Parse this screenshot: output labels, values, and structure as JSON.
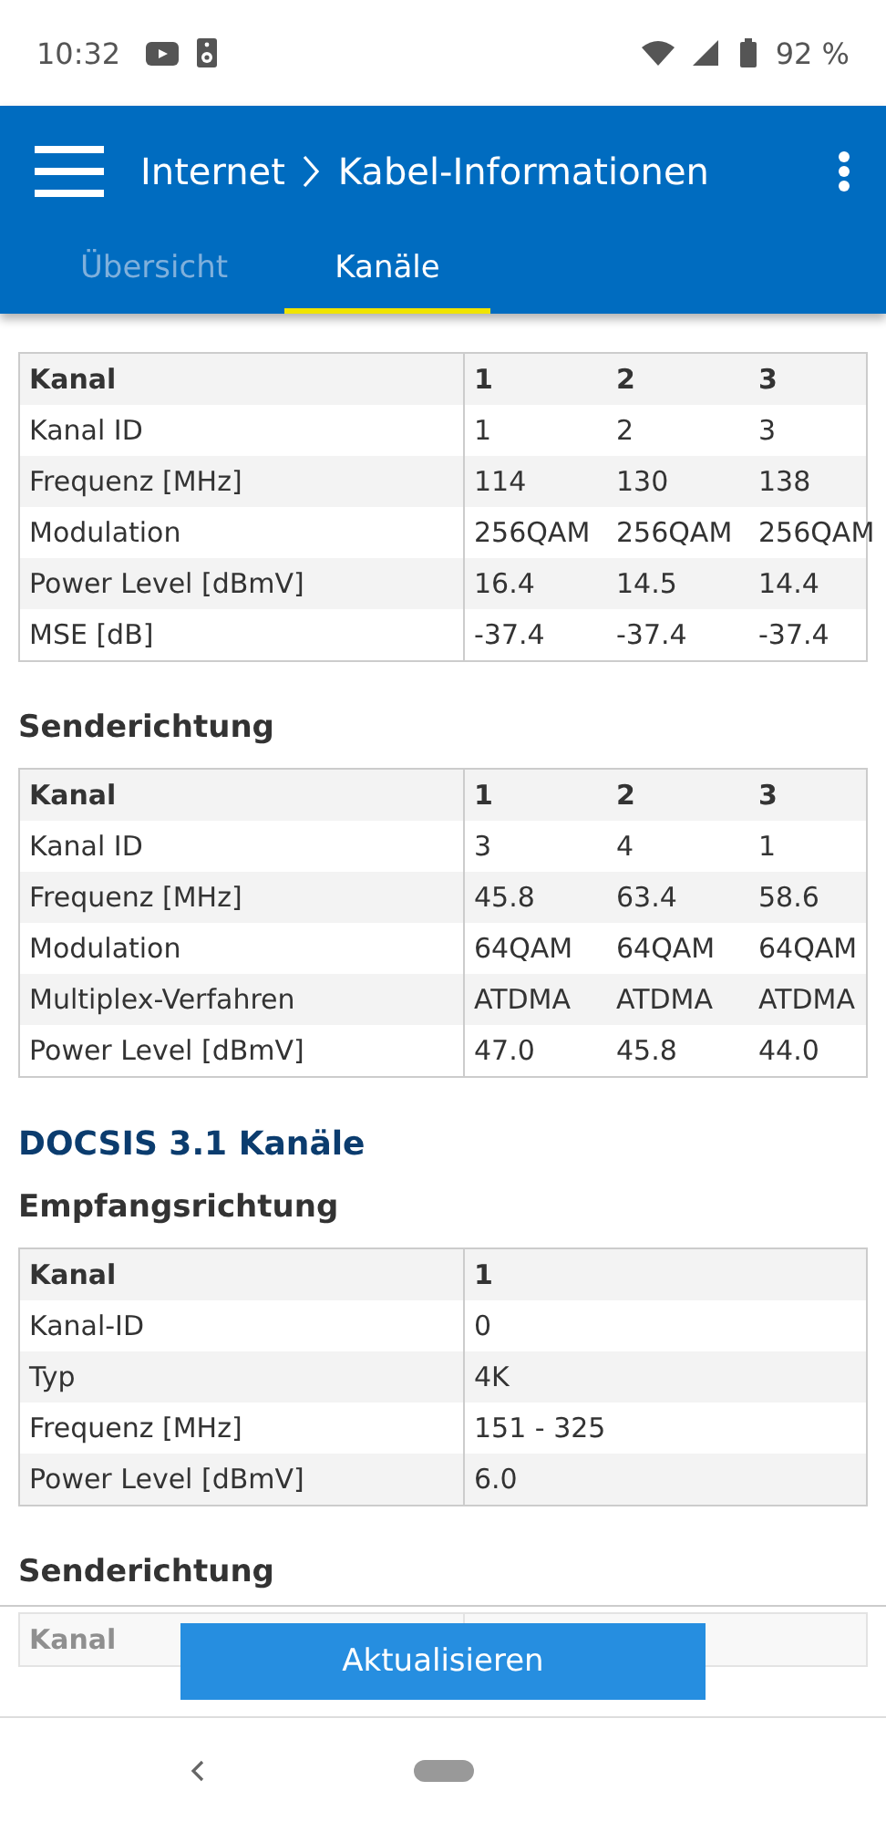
{
  "status_bar": {
    "time": "10:32",
    "battery": "92 %"
  },
  "app_bar": {
    "title": "Internet",
    "subtitle": "Kabel-Informationen"
  },
  "tabs": [
    {
      "label": "Übersicht",
      "selected": false
    },
    {
      "label": "Kanäle",
      "selected": true
    }
  ],
  "content": [
    {
      "kind": "table",
      "header": [
        "Kanal",
        "1",
        "2",
        "3"
      ],
      "rows": [
        [
          "Kanal ID",
          "1",
          "2",
          "3"
        ],
        [
          "Frequenz [MHz]",
          "114",
          "130",
          "138"
        ],
        [
          "Modulation",
          "256QAM",
          "256QAM",
          "256QAM"
        ],
        [
          "Power Level [dBmV]",
          "16.4",
          "14.5",
          "14.4"
        ],
        [
          "MSE [dB]",
          "-37.4",
          "-37.4",
          "-37.4"
        ]
      ]
    },
    {
      "kind": "subheading",
      "text": "Senderichtung"
    },
    {
      "kind": "table",
      "header": [
        "Kanal",
        "1",
        "2",
        "3"
      ],
      "rows": [
        [
          "Kanal ID",
          "3",
          "4",
          "1"
        ],
        [
          "Frequenz [MHz]",
          "45.8",
          "63.4",
          "58.6"
        ],
        [
          "Modulation",
          "64QAM",
          "64QAM",
          "64QAM"
        ],
        [
          "Multiplex-Verfahren",
          "ATDMA",
          "ATDMA",
          "ATDMA"
        ],
        [
          "Power Level [dBmV]",
          "47.0",
          "45.8",
          "44.0"
        ]
      ]
    },
    {
      "kind": "heading",
      "text": "DOCSIS 3.1 Kanäle"
    },
    {
      "kind": "subheading",
      "text": "Empfangsrichtung"
    },
    {
      "kind": "table",
      "header": [
        "Kanal",
        "1"
      ],
      "rows": [
        [
          "Kanal-ID",
          "0"
        ],
        [
          "Typ",
          "4K"
        ],
        [
          "Frequenz [MHz]",
          "151 - 325"
        ],
        [
          "Power Level [dBmV]",
          "6.0"
        ]
      ]
    },
    {
      "kind": "subheading",
      "text": "Senderichtung"
    },
    {
      "kind": "table",
      "header": [
        "Kanal"
      ]
    }
  ],
  "action_button": "Aktualisieren"
}
